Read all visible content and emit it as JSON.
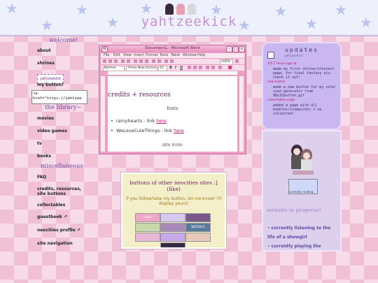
{
  "header": {
    "title": "yahtzeekick",
    "mascot_colors": [
      "#e8a0b0",
      "#3b2b3b",
      "#f0f0f0"
    ]
  },
  "sidebar": {
    "welcome_heading": "welcome!",
    "library_heading": "the library~",
    "misc_heading": "miscellaneous",
    "links_top": [
      "about",
      "shrines"
    ],
    "my_button_label": "my button!",
    "my_button_image_text": "yahtzeekick",
    "button_code": "<a\nhref=\"https://yahtzee",
    "library_links": [
      "movies",
      "video games",
      "tv",
      "books"
    ],
    "misc_links": [
      "FAQ",
      "credits, resources, site buttons",
      "collectables",
      "guestbook ↗",
      "neocities profile ↗",
      "site navigation"
    ]
  },
  "word_window": {
    "title": "Document1 - Microsoft Word",
    "menu": [
      "File",
      "Edit",
      "View",
      "Insert",
      "Format",
      "Tools",
      "Table",
      "Window",
      "Help"
    ],
    "style": "Normal",
    "font": "Times New Roman",
    "size": "12",
    "zoom": "100%",
    "heading": "credits + resources",
    "fonts_label": "fonts",
    "items": [
      {
        "text": "rainyhearts - link ",
        "link": "here"
      },
      {
        "text": "WeLoveCuteThings - link ",
        "link": "here"
      }
    ],
    "site_icon_label": "site icon:"
  },
  "buttons_box": {
    "title": "buttons of other neocities sites :] (like)",
    "subtitle": "if you follow/take my button, let me know! i'll display yours!",
    "buttons": [
      {
        "label": "sailor",
        "color": "#f0a8c8"
      },
      {
        "label": "",
        "color": "#d8c8f0"
      },
      {
        "label": "",
        "color": "#7a5a8a"
      },
      {
        "label": "",
        "color": "#c8d8a8"
      },
      {
        "label": "",
        "color": "#a88ab8"
      },
      {
        "label": "NOODLE",
        "color": "#5a7a9a"
      },
      {
        "label": "",
        "color": "#e8b8d8"
      },
      {
        "label": "",
        "color": "#c8a8e8"
      },
      {
        "label": "",
        "color": "#e8c8b8"
      },
      {
        "label": "",
        "color": "#3a2a4a"
      }
    ]
  },
  "updates": {
    "title": "updates",
    "subtitle": "yahtzeekick",
    "entries": [
      {
        "date": "2/4 7 hours ago at",
        "text": "made my first shrine/interest page, for final fantasy xiv. check it out!"
      },
      {
        "date": "new button",
        "text": "made a new button for my site! used generator from 88x31button.gif"
      },
      {
        "date": "collectables page",
        "text": "added a page with all bubbles/stamps/etc i've collected!"
      }
    ]
  },
  "side_card": {
    "gif_caption": "currently reading",
    "wip_title": "website in progress!",
    "list": [
      {
        "prefix": "currently listening to the",
        "value": "life of a showgirl"
      },
      {
        "prefix": "currently playing the",
        "value": ""
      }
    ]
  }
}
